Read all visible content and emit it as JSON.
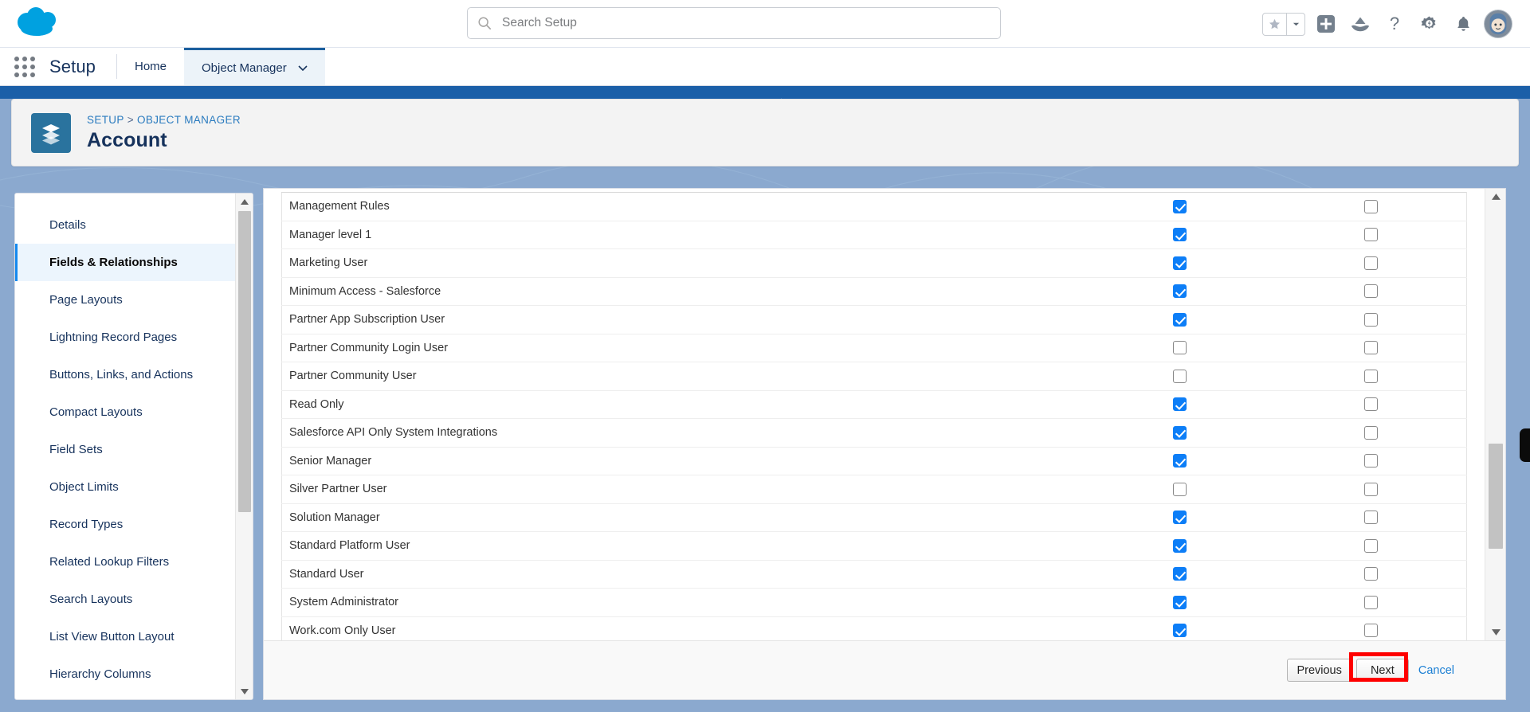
{
  "header": {
    "logo_icon": "salesforce-cloud-logo",
    "search": {
      "placeholder": "Search Setup",
      "value": "",
      "icon": "search-icon"
    },
    "actions": [
      {
        "name": "favorites-star-icon",
        "glyph": "star"
      },
      {
        "name": "favorites-dropdown-icon",
        "glyph": "caret-down"
      },
      {
        "name": "global-create-icon",
        "glyph": "plus-square"
      },
      {
        "name": "einstein-icon",
        "glyph": "mountain"
      },
      {
        "name": "help-icon",
        "glyph": "question-mark"
      },
      {
        "name": "setup-gear-icon",
        "glyph": "gear"
      },
      {
        "name": "notifications-bell-icon",
        "glyph": "bell"
      },
      {
        "name": "user-avatar",
        "glyph": "avatar"
      }
    ]
  },
  "setup_bar": {
    "app_launcher_icon": "app-launcher-icon",
    "title": "Setup",
    "tabs": [
      {
        "label": "Home",
        "active": false,
        "has_caret": false
      },
      {
        "label": "Object Manager",
        "active": true,
        "has_caret": true
      }
    ]
  },
  "record_header": {
    "icon": "object-layers-icon",
    "breadcrumb": {
      "setup": "SETUP",
      "separator": ">",
      "object_manager": "OBJECT MANAGER"
    },
    "title": "Account"
  },
  "sidebar": {
    "items": [
      {
        "label": "Details",
        "active": false
      },
      {
        "label": "Fields & Relationships",
        "active": true
      },
      {
        "label": "Page Layouts",
        "active": false
      },
      {
        "label": "Lightning Record Pages",
        "active": false
      },
      {
        "label": "Buttons, Links, and Actions",
        "active": false
      },
      {
        "label": "Compact Layouts",
        "active": false
      },
      {
        "label": "Field Sets",
        "active": false
      },
      {
        "label": "Object Limits",
        "active": false
      },
      {
        "label": "Record Types",
        "active": false
      },
      {
        "label": "Related Lookup Filters",
        "active": false
      },
      {
        "label": "Search Layouts",
        "active": false
      },
      {
        "label": "List View Button Layout",
        "active": false
      },
      {
        "label": "Hierarchy Columns",
        "active": false
      }
    ]
  },
  "main": {
    "table": {
      "rows": [
        {
          "profile": "Management Rules",
          "visible": true,
          "read_only": false
        },
        {
          "profile": "Manager level 1",
          "visible": true,
          "read_only": false
        },
        {
          "profile": "Marketing User",
          "visible": true,
          "read_only": false
        },
        {
          "profile": "Minimum Access - Salesforce",
          "visible": true,
          "read_only": false
        },
        {
          "profile": "Partner App Subscription User",
          "visible": true,
          "read_only": false
        },
        {
          "profile": "Partner Community Login User",
          "visible": false,
          "read_only": false
        },
        {
          "profile": "Partner Community User",
          "visible": false,
          "read_only": false
        },
        {
          "profile": "Read Only",
          "visible": true,
          "read_only": false
        },
        {
          "profile": "Salesforce API Only System Integrations",
          "visible": true,
          "read_only": false
        },
        {
          "profile": "Senior Manager",
          "visible": true,
          "read_only": false
        },
        {
          "profile": "Silver Partner User",
          "visible": false,
          "read_only": false
        },
        {
          "profile": "Solution Manager",
          "visible": true,
          "read_only": false
        },
        {
          "profile": "Standard Platform User",
          "visible": true,
          "read_only": false
        },
        {
          "profile": "Standard User",
          "visible": true,
          "read_only": false
        },
        {
          "profile": "System Administrator",
          "visible": true,
          "read_only": false
        },
        {
          "profile": "Work.com Only User",
          "visible": true,
          "read_only": false
        }
      ]
    },
    "footer": {
      "previous_label": "Previous",
      "next_label": "Next",
      "cancel_label": "Cancel",
      "highlighted_button": "Next",
      "highlight_color": "#ff0000"
    }
  },
  "colors": {
    "brand_blue": "#1b5fa8",
    "backdrop_blue": "#8ba9cf",
    "link_blue": "#2a7bbf",
    "checkbox_checked": "#0d7ef7",
    "active_nav": "#1589ee"
  }
}
